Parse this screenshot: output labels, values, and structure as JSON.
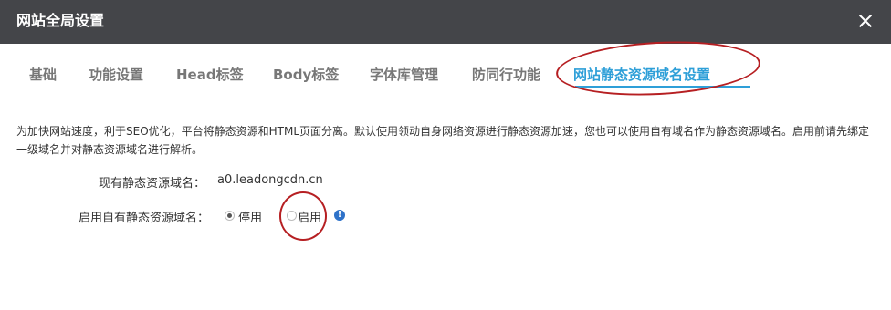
{
  "dialog": {
    "title": "网站全局设置",
    "close_icon": "close-icon"
  },
  "tabs": [
    {
      "label": "基础",
      "active": false
    },
    {
      "label": "功能设置",
      "active": false
    },
    {
      "label": "Head标签",
      "active": false
    },
    {
      "label": "Body标签",
      "active": false
    },
    {
      "label": "字体库管理",
      "active": false
    },
    {
      "label": "防同行功能",
      "active": false
    },
    {
      "label": "网站静态资源域名设置",
      "active": true
    }
  ],
  "content": {
    "description": "为加快网站速度，利于SEO优化，平台将静态资源和HTML页面分离。默认使用领动自身网络资源进行静态资源加速，您也可以使用自有域名作为静态资源域名。启用前请先绑定一级域名并对静态资源域名进行解析。",
    "current_domain_label": "现有静态资源域名：",
    "current_domain_value": "a0.leadongcdn.cn",
    "enable_label": "启用自有静态资源域名：",
    "options": [
      {
        "label": "停用",
        "checked": true
      },
      {
        "label": "启用",
        "checked": false
      }
    ],
    "info_icon": "info-icon",
    "info_glyph": "!"
  },
  "colors": {
    "titlebar": "#444549",
    "accent": "#2e9fd8",
    "annotation": "#b61f22",
    "info": "#2e72c9"
  }
}
